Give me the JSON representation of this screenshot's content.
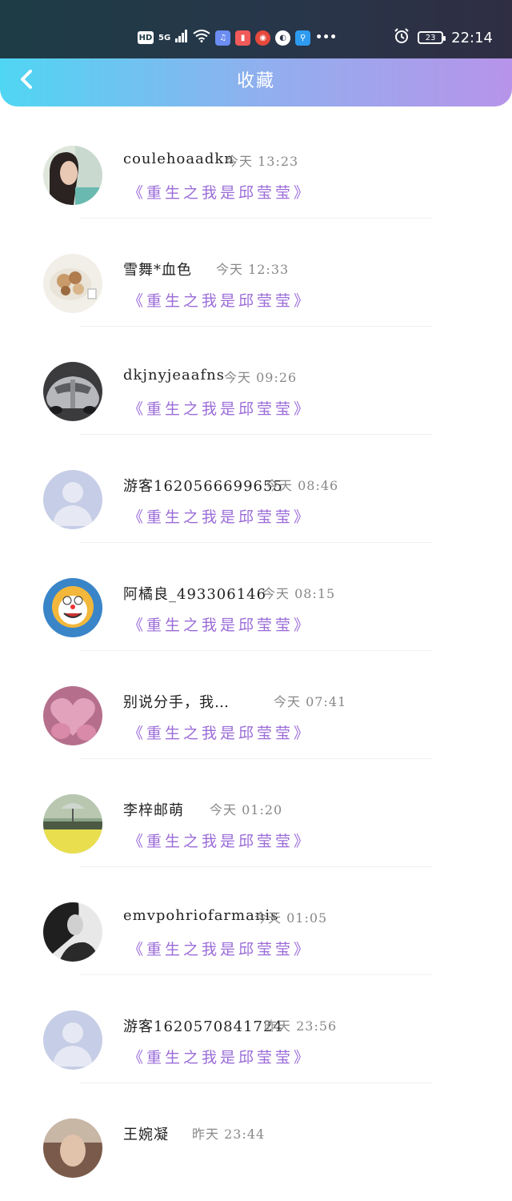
{
  "status_bar": {
    "hd": "HD",
    "network": "5G",
    "battery": "23",
    "time": "22:14",
    "app_icons": [
      "music-icon",
      "book-icon",
      "weibo-icon",
      "browser-icon",
      "search-app-icon"
    ],
    "app_colors": [
      "#6b8cf0",
      "#f05a5a",
      "#e64a3c",
      "#ffffff",
      "#2e9bf0"
    ]
  },
  "nav": {
    "title": "收藏"
  },
  "list": [
    {
      "name": "coulehoaadkn",
      "time": "今天 13:23",
      "book": "《重生之我是邱莹莹》",
      "avatar": "photo-woman"
    },
    {
      "name": "雪舞*血色",
      "time": "今天 12:33",
      "book": "《重生之我是邱莹莹》",
      "avatar": "food"
    },
    {
      "name": "dkjnyjeaafns",
      "time": "今天 09:26",
      "book": "《重生之我是邱莹莹》",
      "avatar": "car"
    },
    {
      "name": "游客1620566699655",
      "time": "今天 08:46",
      "book": "《重生之我是邱莹莹》",
      "avatar": "default"
    },
    {
      "name": "阿橘良_493306146",
      "time": "今天 08:15",
      "book": "《重生之我是邱莹莹》",
      "avatar": "cartoon-cat"
    },
    {
      "name": "别说分手，我…",
      "time": "今天 07:41",
      "book": "《重生之我是邱莹莹》",
      "avatar": "heart"
    },
    {
      "name": "李梓邮萌",
      "time": "今天 01:20",
      "book": "《重生之我是邱莹莹》",
      "avatar": "umbrella"
    },
    {
      "name": "emvpohriofarmanis",
      "time": "今天 01:05",
      "book": "《重生之我是邱莹莹》",
      "avatar": "bw-portrait"
    },
    {
      "name": "游客1620570841724",
      "time": "昨天 23:56",
      "book": "《重生之我是邱莹莹》",
      "avatar": "default"
    },
    {
      "name": "王婉凝",
      "time": "昨天 23:44",
      "book": "",
      "avatar": "photo-partial"
    }
  ]
}
